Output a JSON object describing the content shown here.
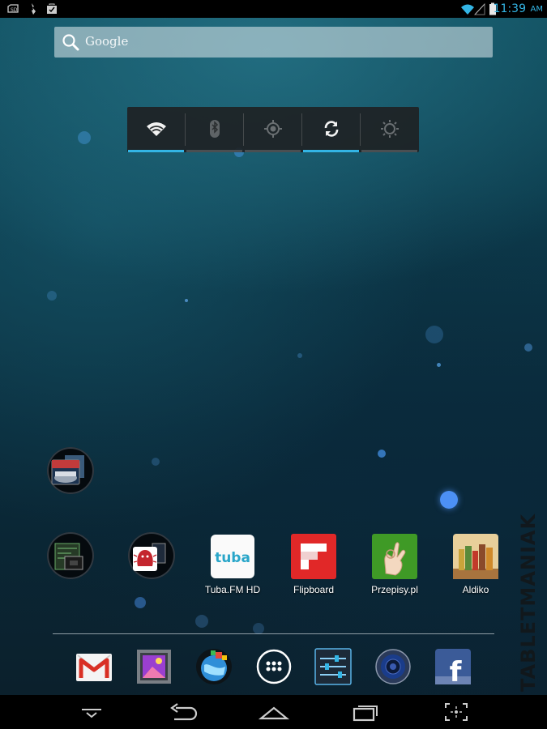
{
  "status_bar": {
    "time": "11:39",
    "ampm": "AM",
    "left_icons": [
      "sd-card-icon",
      "usb-debug-icon",
      "download-done-icon"
    ],
    "right_icons": [
      "wifi-icon",
      "signal-icon",
      "battery-icon"
    ]
  },
  "search": {
    "placeholder": "Google",
    "icon": "search-icon"
  },
  "power_widget": {
    "toggles": [
      {
        "name": "wifi",
        "icon": "wifi-icon",
        "on": true
      },
      {
        "name": "bluetooth",
        "icon": "bluetooth-icon",
        "on": false
      },
      {
        "name": "gps",
        "icon": "gps-icon",
        "on": false
      },
      {
        "name": "sync",
        "icon": "sync-icon",
        "on": true
      },
      {
        "name": "brightness",
        "icon": "brightness-icon",
        "on": false
      }
    ]
  },
  "home_apps": {
    "folder_1": {
      "icon": "games-folder-icon",
      "label": ""
    },
    "folder_2": {
      "icon": "benchmark-folder-icon",
      "label": ""
    },
    "folder_3": {
      "icon": "antutu-folder-icon",
      "label": ""
    },
    "apps": [
      {
        "label": "Tuba.FM HD",
        "icon": "tuba-icon",
        "icon_text": "tuba"
      },
      {
        "label": "Flipboard",
        "icon": "flipboard-icon"
      },
      {
        "label": "Przepisy.pl",
        "icon": "przepisy-icon"
      },
      {
        "label": "Aldiko",
        "icon": "aldiko-icon"
      }
    ]
  },
  "dock": {
    "items": [
      {
        "name": "gmail",
        "icon": "gmail-icon"
      },
      {
        "name": "gallery",
        "icon": "gallery-icon"
      },
      {
        "name": "browser",
        "icon": "globe-icon"
      },
      {
        "name": "all-apps",
        "icon": "app-drawer-icon"
      },
      {
        "name": "settings",
        "icon": "settings-icon"
      },
      {
        "name": "music",
        "icon": "speaker-icon"
      },
      {
        "name": "facebook",
        "icon": "facebook-icon",
        "glyph": "f"
      }
    ]
  },
  "nav_bar": {
    "buttons": [
      "hide-keyboard-icon",
      "back-icon",
      "home-icon",
      "recent-apps-icon",
      "screenshot-icon"
    ]
  },
  "watermark": {
    "text": "TABLETMANIAK"
  },
  "colors": {
    "accent": "#33b5e5",
    "statusbar": "#000000"
  }
}
